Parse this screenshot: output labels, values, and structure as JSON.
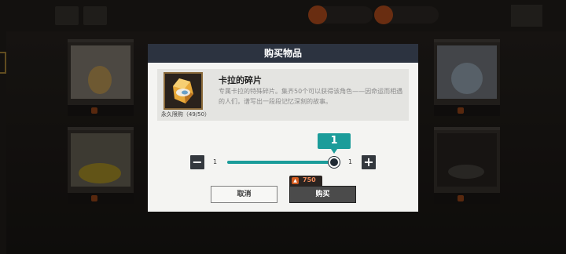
{
  "dialog": {
    "title": "购买物品",
    "item": {
      "name": "卡拉的碎片",
      "description": "专属卡拉的特殊碎片。集齐50个可以获得该角色——因命运而相遇的人们，谱写出一段段记忆深刻的故事。",
      "purchase_limit": "永久限购（49/50）",
      "thumbnail_icon": "crystal-shard-icon"
    },
    "quantity": {
      "selected": "1",
      "min_label": "1",
      "max_label": "1",
      "decrease_symbol": "−",
      "increase_symbol": "+",
      "fill_fraction": 1.0
    },
    "cancel_label": "取消",
    "buy_label": "购买",
    "cost": {
      "icon": "currency-flame-icon",
      "value": "750"
    }
  },
  "colors": {
    "header": "#2c3340",
    "accent_teal": "#1b9c9a",
    "cost_text": "#f08a5a"
  }
}
